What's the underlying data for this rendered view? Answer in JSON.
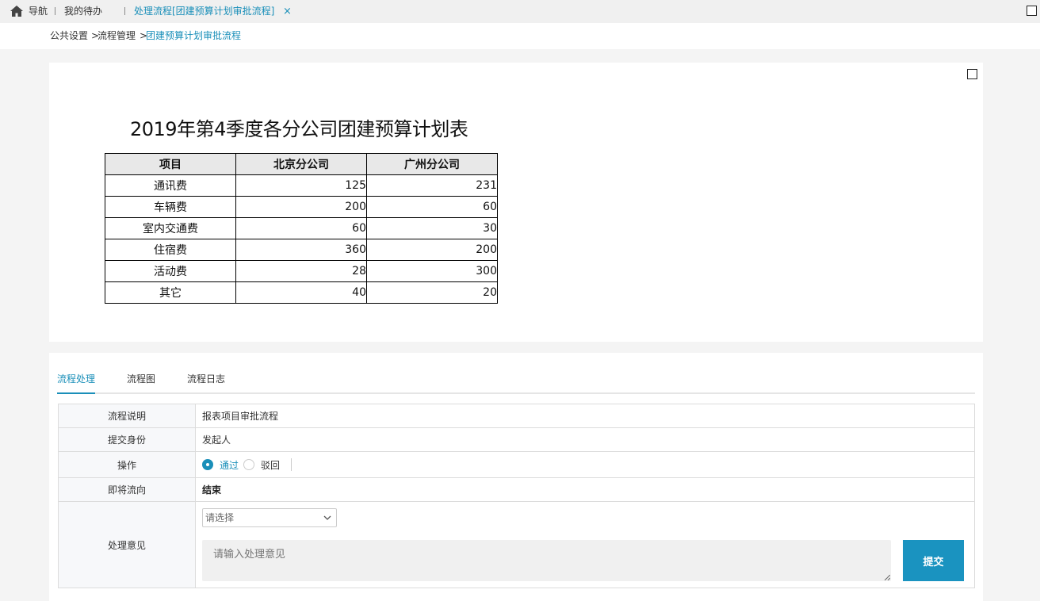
{
  "topbar": {
    "nav_label": "导航",
    "todo_label": "我的待办",
    "active_tab_label": "处理流程[团建预算计划审批流程]",
    "close_glyph": "×",
    "home_icon": "home-icon",
    "maximize_icon": "square-icon"
  },
  "breadcrumb": {
    "items": [
      "公共设置",
      "流程管理",
      "团建预算计划审批流程"
    ],
    "separator": ">"
  },
  "report": {
    "title": "2019年第4季度各分公司团建预算计划表",
    "fullscreen_icon": "square-icon",
    "columns": [
      "项目",
      "北京分公司",
      "广州分公司"
    ],
    "rows": [
      {
        "item": "通讯费",
        "beijing": "125",
        "guangzhou": "231"
      },
      {
        "item": "车辆费",
        "beijing": "200",
        "guangzhou": "60"
      },
      {
        "item": "室内交通费",
        "beijing": "60",
        "guangzhou": "30"
      },
      {
        "item": "住宿费",
        "beijing": "360",
        "guangzhou": "200"
      },
      {
        "item": "活动费",
        "beijing": "28",
        "guangzhou": "300"
      },
      {
        "item": "其它",
        "beijing": "40",
        "guangzhou": "20"
      }
    ]
  },
  "process": {
    "tabs": [
      {
        "label": "流程处理",
        "active": true
      },
      {
        "label": "流程图",
        "active": false
      },
      {
        "label": "流程日志",
        "active": false
      }
    ],
    "form": {
      "description_label": "流程说明",
      "description_value": "报表项目审批流程",
      "identity_label": "提交身份",
      "identity_value": "发起人",
      "action_label": "操作",
      "action_options": [
        {
          "label": "通过",
          "selected": true
        },
        {
          "label": "驳回",
          "selected": false
        }
      ],
      "next_label": "即将流向",
      "next_value": "结束",
      "opinion_label": "处理意见",
      "select_placeholder": "请选择",
      "textarea_placeholder": "请输入处理意见",
      "submit_label": "提交"
    }
  },
  "colors": {
    "accent": "#1a8fb9",
    "submit_bg": "#1a93c0",
    "page_bg": "#f4f4f4"
  }
}
